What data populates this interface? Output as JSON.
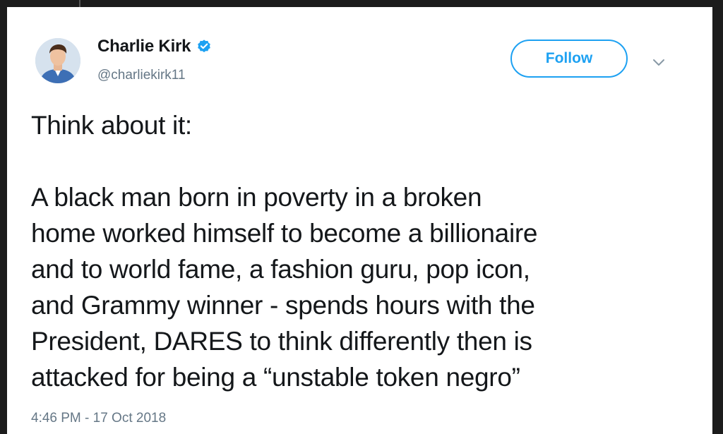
{
  "author": {
    "name": "Charlie Kirk",
    "handle": "@charliekirk11",
    "verified": true,
    "avatar_icon": "profile-photo"
  },
  "actions": {
    "follow_label": "Follow",
    "menu_icon": "chevron-down-icon"
  },
  "tweet": {
    "text": "Think about it:\n\nA black man born in poverty in a broken\nhome worked himself to become a billionaire\nand to world fame, a fashion guru, pop icon,\nand Grammy winner - spends hours with the\nPresident, DARES to think differently then is\nattacked for being a “unstable token negro”",
    "timestamp": "4:46 PM - 17 Oct 2018"
  },
  "colors": {
    "accent": "#1da1f2",
    "text": "#14171a",
    "secondary": "#657786"
  }
}
